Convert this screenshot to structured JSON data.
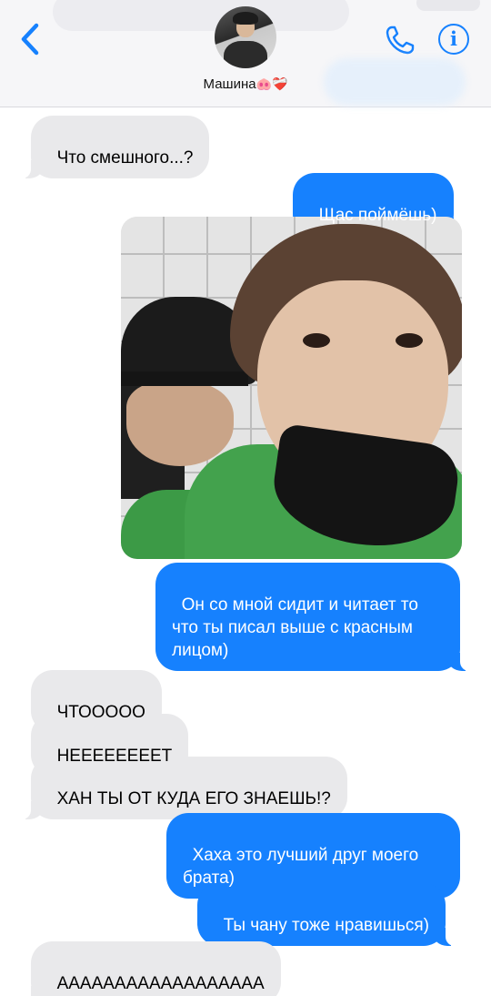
{
  "contact": {
    "name": "Машина",
    "name_emoji": "🐽❤️‍🩹"
  },
  "icons": {
    "back": "chevron-left-icon",
    "call": "phone-icon",
    "info": "info-icon",
    "info_glyph": "i"
  },
  "colors": {
    "accent": "#1681fe",
    "incoming_bubble": "#e9e9eb",
    "header_bg": "#f6f6f8"
  },
  "messages": [
    {
      "direction": "in",
      "text": "Что смешного...?"
    },
    {
      "direction": "out",
      "text": "Щас поймёшь)"
    },
    {
      "direction": "out",
      "type": "photo"
    },
    {
      "direction": "out",
      "text": "Он со мной сидит и читает то что ты писал выше с красным лицом)"
    },
    {
      "direction": "in",
      "text": "ЧТООООО"
    },
    {
      "direction": "in",
      "text": "НЕЕЕЕЕЕЕЕТ"
    },
    {
      "direction": "in",
      "text": "ХАН ТЫ ОТ КУДА ЕГО ЗНАЕШЬ!?"
    },
    {
      "direction": "out",
      "text": "Хаха это лучший друг моего брата)"
    },
    {
      "direction": "out",
      "text": "Ты чану тоже нравишься)"
    },
    {
      "direction": "in",
      "text": "АААААААААААААААААА"
    }
  ]
}
